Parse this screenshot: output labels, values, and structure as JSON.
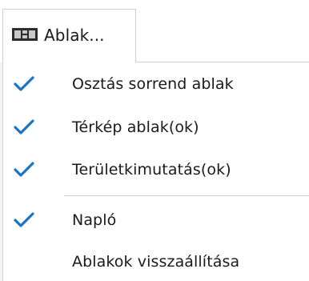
{
  "menu_button": {
    "label": "Ablak...",
    "icon": "window-layout-icon"
  },
  "menu": {
    "items": [
      {
        "label": "Osztás sorrend ablak",
        "checked": true
      },
      {
        "label": "Térkép ablak(ok)",
        "checked": true
      },
      {
        "label": "Területkimutatás(ok)",
        "checked": true
      },
      {
        "label": "Napló",
        "checked": true
      },
      {
        "label": "Ablakok visszaállítása",
        "checked": false
      }
    ]
  },
  "colors": {
    "check": "#1a73c8",
    "text": "#1a1a1a",
    "border": "#cfcfcf"
  }
}
